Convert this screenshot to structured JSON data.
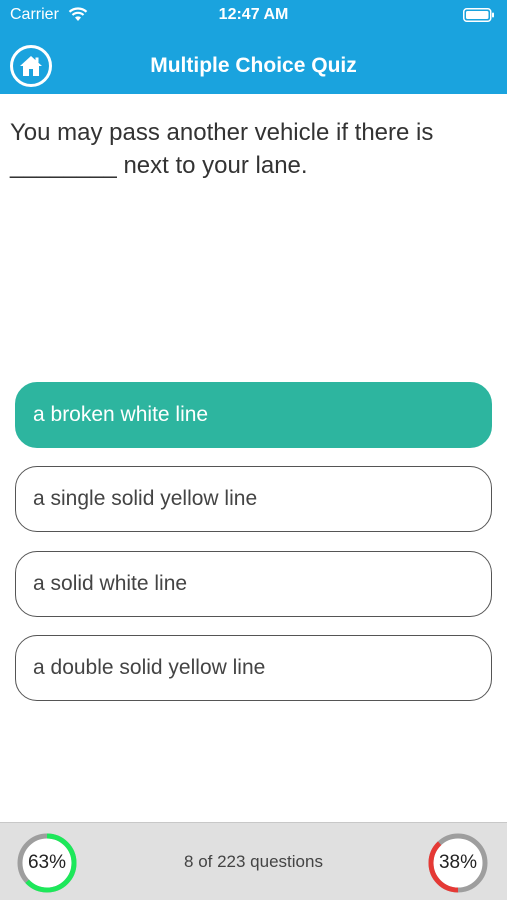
{
  "status_bar": {
    "carrier": "Carrier",
    "time": "12:47 AM",
    "wifi_icon": "wifi-icon",
    "battery_icon": "battery-icon"
  },
  "header": {
    "title": "Multiple Choice Quiz",
    "home_icon": "home-icon",
    "background_color": "#1aa3de"
  },
  "question": {
    "text": "You may pass another vehicle if there is ________ next to your lane."
  },
  "options": [
    {
      "label": "a broken white line",
      "selected": true
    },
    {
      "label": "a single solid yellow line",
      "selected": false
    },
    {
      "label": "a solid white line",
      "selected": false
    },
    {
      "label": "a double solid yellow line",
      "selected": false
    }
  ],
  "footer": {
    "progress_text": "8 of 223 questions",
    "correct_percent": {
      "label": "63%",
      "value": 0.63,
      "color": "#1de85a"
    },
    "wrong_percent": {
      "label": "38%",
      "value": 0.38,
      "color": "#e53935"
    }
  },
  "colors": {
    "selected_option": "#2db59f"
  }
}
